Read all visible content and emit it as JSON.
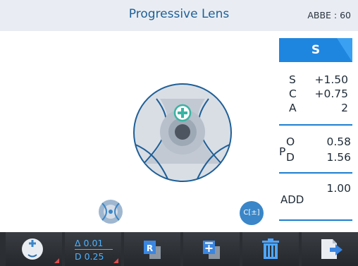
{
  "header": {
    "title": "Progressive Lens",
    "abbe": "ABBE : 60"
  },
  "panel": {
    "mode_tab": "S",
    "s_label": "S",
    "s_value": "+1.50",
    "c_label": "C",
    "c_value": "+0.75",
    "a_label": "A",
    "a_value": "2",
    "p_label": "P",
    "o_label": "O",
    "o_value": "0.58",
    "d_label": "D",
    "d_value": "1.56",
    "add_label": "ADD",
    "add_value": "1.00"
  },
  "tolerance": {
    "delta": "Δ 0.01",
    "d": "D 0.25"
  },
  "c_button": "C[±]",
  "colors": {
    "accent_blue": "#1f86e0",
    "title_blue": "#1f5f96",
    "toolbar_bg": "#2b2e33",
    "target_green": "#3bb3a3",
    "corner_red": "#e14b4b"
  },
  "icons": {
    "toolbar": [
      "lens-orientation-icon",
      "tolerance-icon",
      "r-record-icon",
      "memory-stack-icon",
      "trash-icon",
      "export-icon"
    ],
    "lens": [
      "crosshair-target-icon",
      "lens-thumbnail-icon",
      "cylinder-toggle-icon"
    ]
  }
}
